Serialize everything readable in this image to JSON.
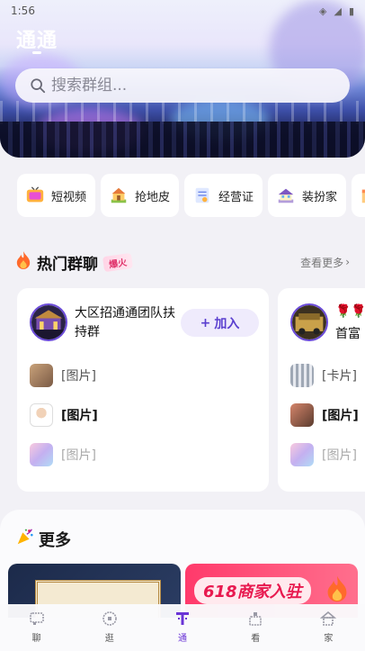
{
  "status_bar": {
    "time": "1:56"
  },
  "header": {
    "title": "通通"
  },
  "search": {
    "placeholder": "搜索群组..."
  },
  "chips": [
    {
      "label": "短视频",
      "icon": "tv-icon"
    },
    {
      "label": "抢地皮",
      "icon": "house-icon"
    },
    {
      "label": "经营证",
      "icon": "certificate-icon"
    },
    {
      "label": "装扮家",
      "icon": "home-decor-icon"
    }
  ],
  "hot_groups": {
    "title": "热门群聊",
    "badge": "爆火",
    "more_label": "查看更多",
    "cards": [
      {
        "name": "大区招通通团队扶持群",
        "join_label": "加入",
        "join_plus": "+",
        "messages": [
          {
            "text": "[图片]",
            "emphasis": false
          },
          {
            "text": "[图片]",
            "emphasis": true
          },
          {
            "text": "[图片]",
            "emphasis": false,
            "faded": true
          }
        ]
      },
      {
        "name": "首富",
        "name_prefix": "🌹🌹",
        "messages": [
          {
            "text": "[卡片]",
            "emphasis": false
          },
          {
            "text": "[图片]",
            "emphasis": true
          },
          {
            "text": "[图片]",
            "emphasis": false,
            "faded": true
          }
        ]
      }
    ]
  },
  "more_section": {
    "title": "更多",
    "promo_text": "618商家入驻"
  },
  "tabbar": {
    "items": [
      {
        "label": "聊",
        "active": false
      },
      {
        "label": "逛",
        "active": false
      },
      {
        "label": "通",
        "active": true
      },
      {
        "label": "看",
        "active": false
      },
      {
        "label": "家",
        "active": false
      }
    ]
  },
  "colors": {
    "accent": "#6a34d6",
    "join_bg": "#efebfc",
    "promo": "#ff3a6b"
  }
}
